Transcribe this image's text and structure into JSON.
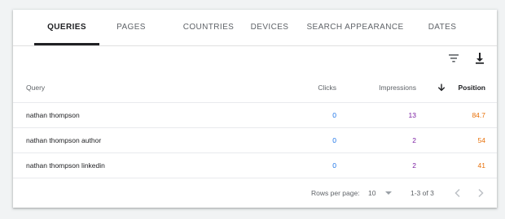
{
  "tabs": [
    {
      "label": "QUERIES"
    },
    {
      "label": "PAGES"
    },
    {
      "label": "COUNTRIES"
    },
    {
      "label": "DEVICES"
    },
    {
      "label": "SEARCH APPEARANCE"
    },
    {
      "label": "DATES"
    }
  ],
  "active_tab": "QUERIES",
  "toolbar": {
    "filter_icon": "filter-icon",
    "download_icon": "download-icon"
  },
  "table": {
    "headers": {
      "query": "Query",
      "clicks": "Clicks",
      "impressions": "Impressions",
      "position": "Position"
    },
    "sort": {
      "column": "position",
      "direction": "descending",
      "icon": "arrow-down-icon"
    },
    "rows": [
      {
        "query": "nathan thompson",
        "clicks": "0",
        "impressions": "13",
        "position": "84.7"
      },
      {
        "query": "nathan thompson author",
        "clicks": "0",
        "impressions": "2",
        "position": "54"
      },
      {
        "query": "nathan thompson linkedin",
        "clicks": "0",
        "impressions": "2",
        "position": "41"
      }
    ]
  },
  "pagination": {
    "rows_per_page_label": "Rows per page:",
    "rows_per_page_value": "10",
    "range": "1-3 of 3"
  },
  "colors": {
    "clicks": "#1a73e8",
    "impressions": "#7b1fa2",
    "position": "#e8710a",
    "active_tab": "#202124"
  }
}
